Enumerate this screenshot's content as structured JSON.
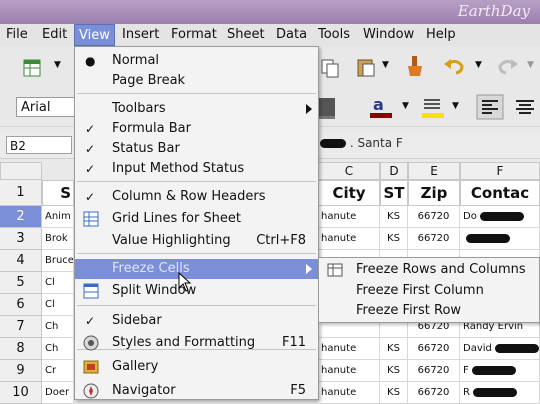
{
  "window": {
    "title": "EarthDay"
  },
  "menubar": [
    "File",
    "Edit",
    "View",
    "Insert",
    "Format",
    "Sheet",
    "Data",
    "Tools",
    "Window",
    "Help"
  ],
  "toolbar": {
    "font_name": "Arial"
  },
  "formula_bar": {
    "cell_ref": "B2",
    "content": ". Santa F"
  },
  "sheet": {
    "columns": [
      "C",
      "D",
      "E",
      "F"
    ],
    "header_row": [
      "City",
      "ST",
      "Zip",
      "Contac"
    ],
    "row_header_stub": "S",
    "rows": [
      "1",
      "2",
      "3",
      "4",
      "5",
      "6",
      "7",
      "8",
      "9",
      "10"
    ],
    "data": [
      {
        "city": "hanute",
        "st": "KS",
        "zip": "66720",
        "contact": "Do"
      },
      {
        "city": "hanute",
        "st": "KS",
        "zip": "66720",
        "contact": ""
      },
      {
        "city": "",
        "st": "",
        "zip": "",
        "contact": ""
      },
      {
        "city": "",
        "st": "",
        "zip": "",
        "contact": ""
      },
      {
        "city": "",
        "st": "",
        "zip": "",
        "contact": ""
      },
      {
        "city": "",
        "st": "",
        "zip": "66720",
        "contact": "Randy Ervin"
      },
      {
        "city": "hanute",
        "st": "KS",
        "zip": "66720",
        "contact": "David"
      },
      {
        "city": "hanute",
        "st": "KS",
        "zip": "66720",
        "contact": "F"
      },
      {
        "city": "hanute",
        "st": "KS",
        "zip": "66720",
        "contact": "R"
      }
    ],
    "b_prefixes": [
      "Anim",
      "Brok",
      "Bruce",
      "Cl",
      "Cl",
      "Ch",
      "Ch",
      "Cr",
      "Doer"
    ]
  },
  "view_menu": {
    "items": [
      {
        "label": "Normal",
        "check": "●",
        "shortcut": "",
        "submenu": false
      },
      {
        "label": "Page Break",
        "check": "",
        "shortcut": "",
        "submenu": false
      },
      {
        "label": "Toolbars",
        "check": "",
        "shortcut": "",
        "submenu": true
      },
      {
        "label": "Formula Bar",
        "check": "✓",
        "shortcut": "",
        "submenu": false
      },
      {
        "label": "Status Bar",
        "check": "✓",
        "shortcut": "",
        "submenu": false
      },
      {
        "label": "Input Method Status",
        "check": "✓",
        "shortcut": "",
        "submenu": false
      },
      {
        "label": "Column & Row Headers",
        "check": "✓",
        "shortcut": "",
        "submenu": false
      },
      {
        "label": "Grid Lines for Sheet",
        "check": "",
        "shortcut": "",
        "submenu": false,
        "icon": "grid-lines-icon"
      },
      {
        "label": "Value Highlighting",
        "check": "",
        "shortcut": "Ctrl+F8",
        "submenu": false
      },
      {
        "label": "Freeze Cells",
        "check": "",
        "shortcut": "",
        "submenu": true
      },
      {
        "label": "Split Window",
        "check": "",
        "shortcut": "",
        "submenu": false,
        "icon": "split-window-icon"
      },
      {
        "label": "Sidebar",
        "check": "✓",
        "shortcut": "",
        "submenu": false
      },
      {
        "label": "Styles and Formatting",
        "check": "",
        "shortcut": "F11",
        "submenu": false,
        "icon": "styles-icon"
      },
      {
        "label": "Gallery",
        "check": "",
        "shortcut": "",
        "submenu": false,
        "icon": "gallery-icon"
      },
      {
        "label": "Navigator",
        "check": "",
        "shortcut": "F5",
        "submenu": false,
        "icon": "navigator-icon"
      }
    ]
  },
  "freeze_submenu": {
    "items": [
      "Freeze Rows and Columns",
      "Freeze First Column",
      "Freeze First Row"
    ]
  },
  "colors": {
    "highlight": "#7a8fd8",
    "titlebar": "#9b7fae"
  }
}
